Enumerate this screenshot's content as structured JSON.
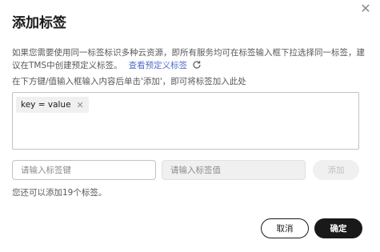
{
  "dialog": {
    "title": "添加标签",
    "close_icon": "close-icon"
  },
  "description": {
    "text": "如果您需要使用同一标签标识多种云资源，即所有服务均可在标签输入框下拉选择同一标签，建议在TMS中创建预定义标签。",
    "link_label": "查看预定义标签",
    "refresh_icon": "refresh-icon"
  },
  "hint": "在下方键/值输入框输入内容后单击'添加'，即可将标签加入此处",
  "tags": [
    {
      "label": "key = value"
    }
  ],
  "inputs": {
    "key_placeholder": "请输入标签键",
    "value_placeholder": "请输入标签值",
    "add_label": "添加"
  },
  "remaining": "您还可以添加19个标签。",
  "footer": {
    "cancel_label": "取消",
    "ok_label": "确定"
  },
  "colors": {
    "primary": "#191919",
    "link": "#526ecc",
    "disabled_bg": "#f0f0f0"
  }
}
